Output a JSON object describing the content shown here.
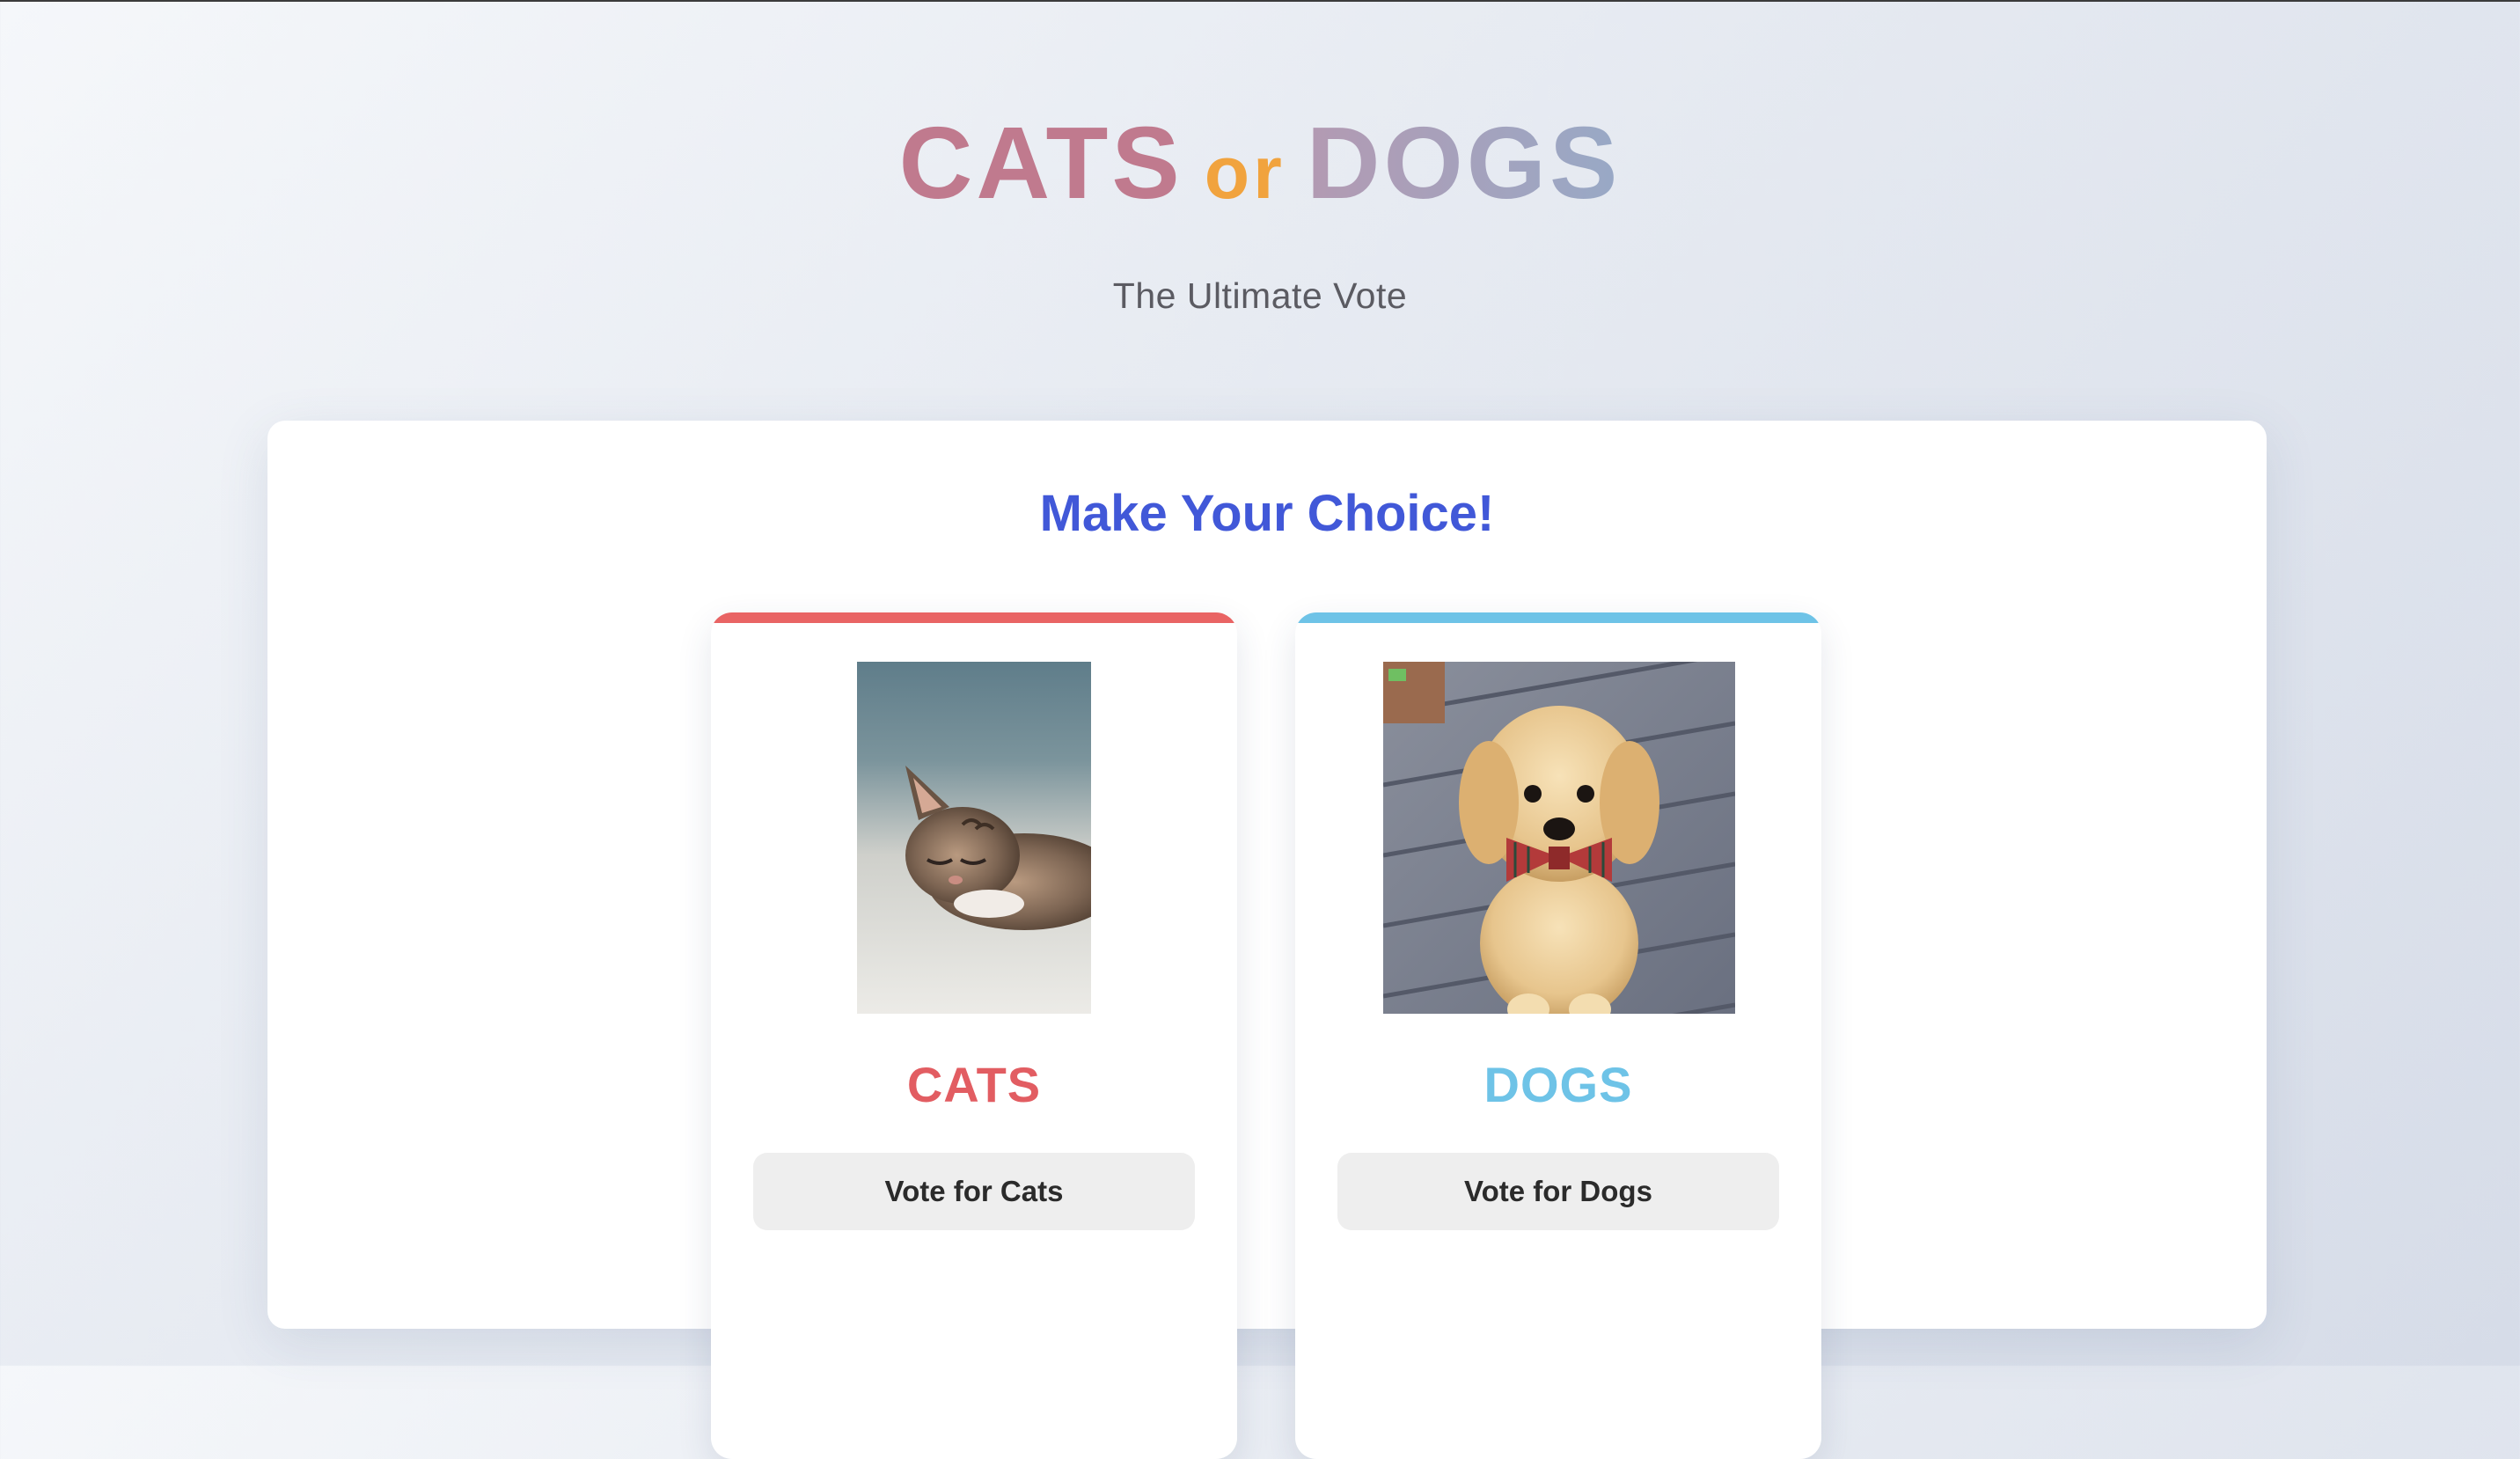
{
  "header": {
    "title_left": "CATS",
    "title_or": "or",
    "title_right": "DOGS",
    "subtitle": "The Ultimate Vote"
  },
  "panel": {
    "heading": "Make Your Choice!"
  },
  "options": [
    {
      "name": "CATS",
      "vote_label": "Vote for Cats",
      "accent_color": "#e96464",
      "image": "sleeping kitten photo"
    },
    {
      "name": "DOGS",
      "vote_label": "Vote for Dogs",
      "accent_color": "#6ec3e7",
      "image": "golden retriever puppy with bow tie photo"
    }
  ],
  "colors": {
    "heading_blue": "#4158d8",
    "or_orange": "#f1a33e"
  }
}
